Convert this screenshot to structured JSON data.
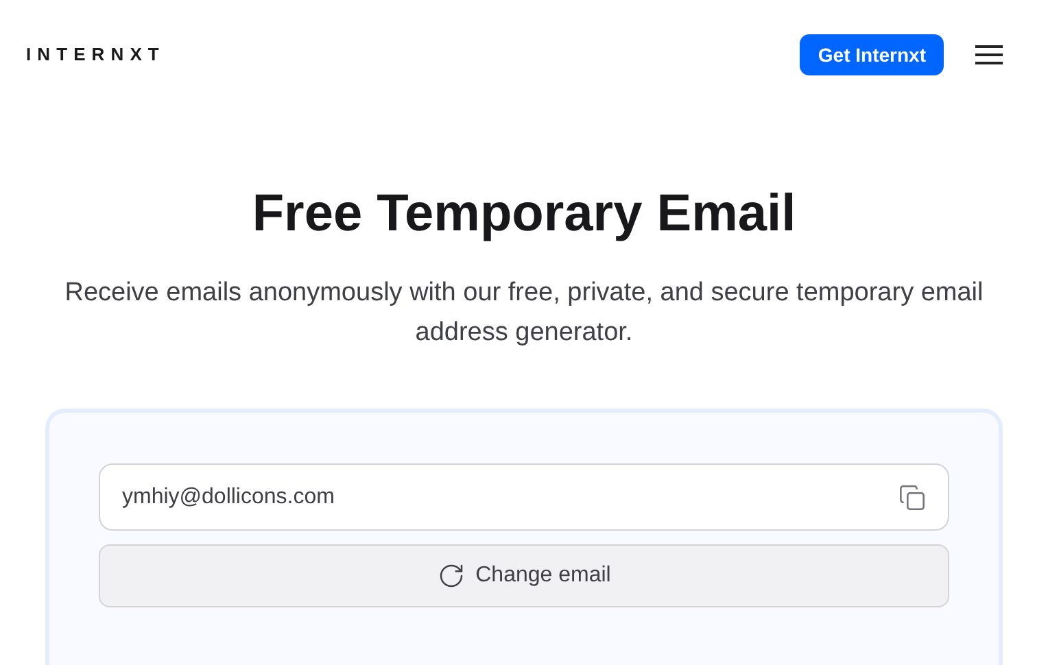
{
  "header": {
    "logo": "INTERNXT",
    "cta": "Get Internxt"
  },
  "hero": {
    "title": "Free Temporary Email",
    "subtitle": "Receive emails anonymously with our free, private, and secure temporary email address generator."
  },
  "email_box": {
    "address": "ymhiy@dollicons.com",
    "change_button": "Change email"
  }
}
